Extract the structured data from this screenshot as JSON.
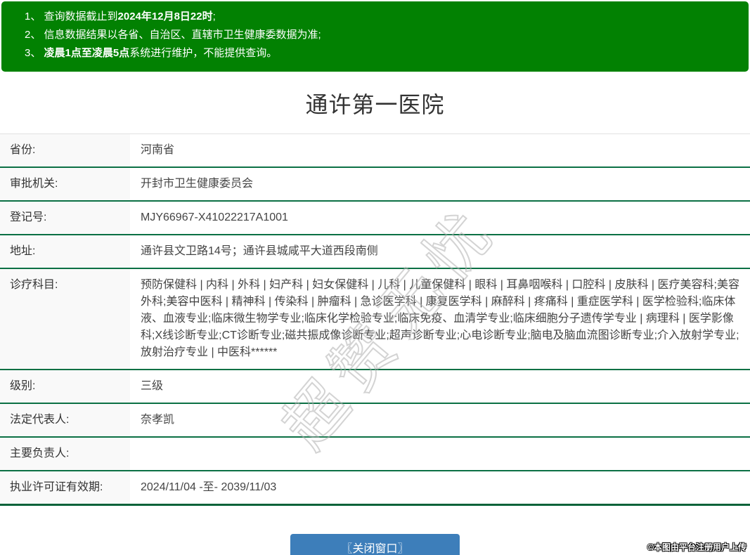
{
  "notice": {
    "items": [
      {
        "pre": "1、 查询数据截止到",
        "bold": "2024年12月8日22时",
        "post": ";"
      },
      {
        "pre": "2、 信息数据结果以各省、自治区、直辖市卫生健康委数据为准;",
        "bold": "",
        "post": ""
      },
      {
        "pre": "3、 ",
        "bold": "凌晨1点至凌晨5点",
        "post": "系统进行维护，不能提供查询。"
      }
    ]
  },
  "title": "通许第一医院",
  "table": {
    "rows": [
      {
        "label": "省份:",
        "value": "河南省"
      },
      {
        "label": "审批机关:",
        "value": "开封市卫生健康委员会"
      },
      {
        "label": "登记号:",
        "value": "MJY66967-X41022217A1001"
      },
      {
        "label": "地址:",
        "value": "通许县文卫路14号；通许县城咸平大道西段南侧"
      },
      {
        "label": "诊疗科目:",
        "value": "预防保健科 | 内科 | 外科 | 妇产科 | 妇女保健科 | 儿科 | 儿童保健科 | 眼科 | 耳鼻咽喉科 | 口腔科 | 皮肤科 | 医疗美容科;美容外科;美容中医科 | 精神科 | 传染科 | 肿瘤科 | 急诊医学科 | 康复医学科 | 麻醉科 | 疼痛科 | 重症医学科 | 医学检验科;临床体液、血液专业;临床微生物学专业;临床化学检验专业;临床免疫、血清学专业;临床细胞分子遗传学专业 | 病理科 | 医学影像科;X线诊断专业;CT诊断专业;磁共振成像诊断专业;超声诊断专业;心电诊断专业;脑电及脑血流图诊断专业;介入放射学专业;放射治疗专业 | 中医科******"
      },
      {
        "label": "级别:",
        "value": "三级"
      },
      {
        "label": "法定代表人:",
        "value": "奈孝凯"
      },
      {
        "label": "主要负责人:",
        "value": ""
      },
      {
        "label": "执业许可证有效期:",
        "value": "2024/11/04 -至- 2039/11/03"
      }
    ]
  },
  "close_button_label": "〖关闭窗口〗",
  "watermark_diagonal": "超赞无忧",
  "upload_note": "©本图由平台注册用户上传",
  "colors": {
    "banner_green": "#028102",
    "row_border_green": "#0b7044",
    "bottom_border_green": "#076239",
    "button_blue": "#3d7eba",
    "label_bg": "#f9f9f9"
  }
}
